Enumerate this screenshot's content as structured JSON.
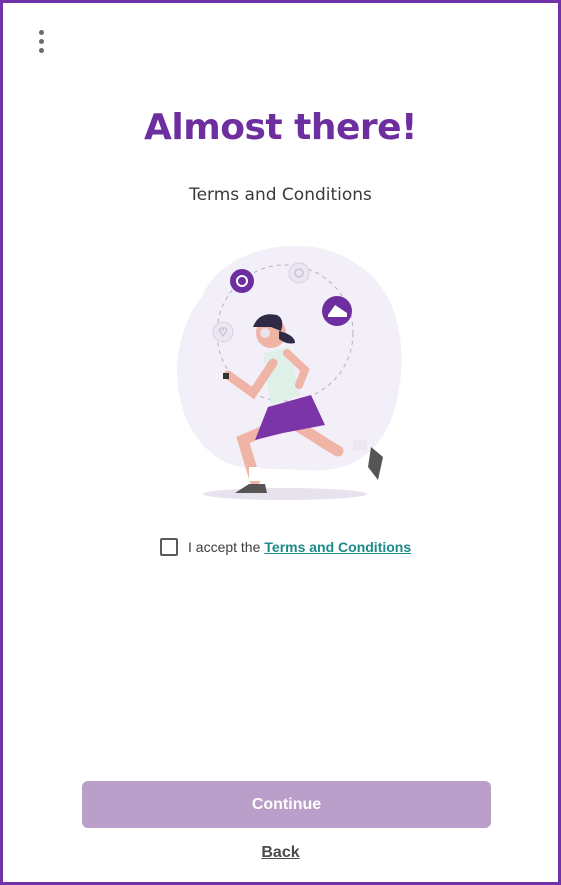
{
  "header": {
    "menu_icon": "more-vertical-icon",
    "title": "Almost there!",
    "subtitle": "Terms and Conditions"
  },
  "illustration": {
    "description_icon": "runner-illustration",
    "icons": [
      "music-icon",
      "chart-icon",
      "shoe-icon",
      "heart-icon"
    ]
  },
  "consent": {
    "checked": false,
    "prefix": "I accept the",
    "link_label": "Terms and Conditions"
  },
  "actions": {
    "continue_label": "Continue",
    "back_label": "Back"
  },
  "colors": {
    "brand": "#6d2f9f",
    "frame": "#6f32a8",
    "button_disabled": "#bb9fcb",
    "link": "#1c8a8a"
  }
}
